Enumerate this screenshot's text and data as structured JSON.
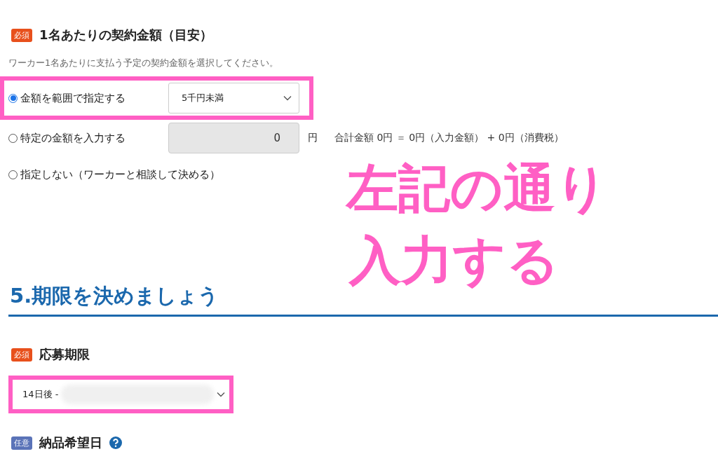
{
  "amount_section": {
    "badge": {
      "kind": "required",
      "label": "必須"
    },
    "title": "1名あたりの契約金額（目安）",
    "description": "ワーカー1名あたりに支払う予定の契約金額を選択してください。",
    "options": [
      {
        "kind": "select",
        "label": "金額を範囲で指定する",
        "selected": true,
        "highlighted": true,
        "value": "5千円未満"
      },
      {
        "kind": "input",
        "label": "特定の金額を入力する",
        "selected": false,
        "highlighted": false,
        "value": "0",
        "unit": "円",
        "total": "合計金額 0円 ＝ 0円（入力金額） + 0円（消費税）"
      },
      {
        "kind": "none",
        "label": "指定しない（ワーカーと相談して決める）",
        "selected": false,
        "highlighted": false
      }
    ]
  },
  "step_heading": "5.期限を決めましょう",
  "deadline": {
    "badge": {
      "kind": "required",
      "label": "必須"
    },
    "title": "応募期限",
    "value": "14日後 -",
    "highlighted": true
  },
  "delivery": {
    "badge": {
      "kind": "optional",
      "label": "任意"
    },
    "title": "納品希望日"
  },
  "annotation": {
    "lines": [
      "左記の通り",
      "入力する"
    ]
  }
}
